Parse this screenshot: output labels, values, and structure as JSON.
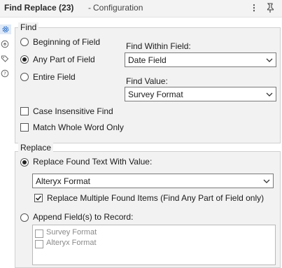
{
  "titlebar": {
    "tool_name": "Find Replace (23)",
    "separator": "-",
    "section": "Configuration"
  },
  "sidebar": {
    "icons": [
      "gear-icon",
      "connection-icon",
      "tag-icon",
      "help-icon"
    ]
  },
  "find": {
    "group_label": "Find",
    "options": [
      {
        "label": "Beginning of Field",
        "selected": false
      },
      {
        "label": "Any Part of Field",
        "selected": true
      },
      {
        "label": "Entire Field",
        "selected": false
      }
    ],
    "within_label": "Find Within Field:",
    "within_value": "Date Field",
    "value_label": "Find Value:",
    "value_value": "Survey Format",
    "case_insensitive_label": "Case Insensitive Find",
    "case_insensitive_checked": false,
    "match_whole_label": "Match Whole Word Only",
    "match_whole_checked": false
  },
  "replace": {
    "group_label": "Replace",
    "replace_found_label": "Replace Found Text With Value:",
    "replace_found_selected": true,
    "replace_value": "Alteryx Format",
    "multiple_label": "Replace Multiple Found Items (Find Any Part of Field only)",
    "multiple_checked": true,
    "append_label": "Append Field(s) to Record:",
    "append_selected": false,
    "append_fields": [
      {
        "label": "Survey Format",
        "checked": false
      },
      {
        "label": "Alteryx Format",
        "checked": false
      }
    ]
  }
}
